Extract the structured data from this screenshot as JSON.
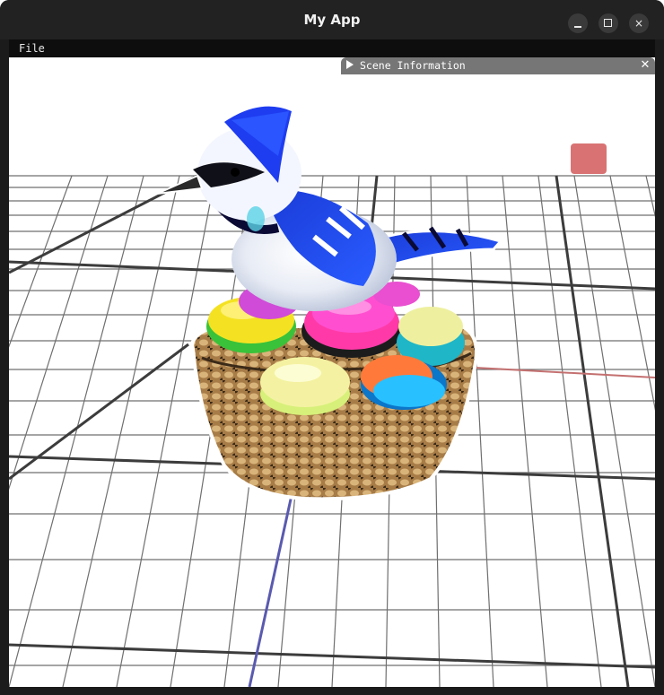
{
  "window": {
    "title": "My App",
    "controls": {
      "minimize": "minimize-icon",
      "maximize": "maximize-icon",
      "close": "×"
    }
  },
  "menu": {
    "file_label": "File"
  },
  "panel": {
    "title": "Scene Information",
    "collapse_icon": "triangle-right-icon",
    "close_glyph": "✕"
  },
  "scene": {
    "background": "#ffffff",
    "grid_color": "#6f6f6f",
    "grid_major_color": "#3c3c3c",
    "axis_x_color": "#c47070",
    "axis_z_color": "#5a5ab0",
    "object": "blue jay on macaron basket",
    "far_object_color": "#d25a5a"
  }
}
